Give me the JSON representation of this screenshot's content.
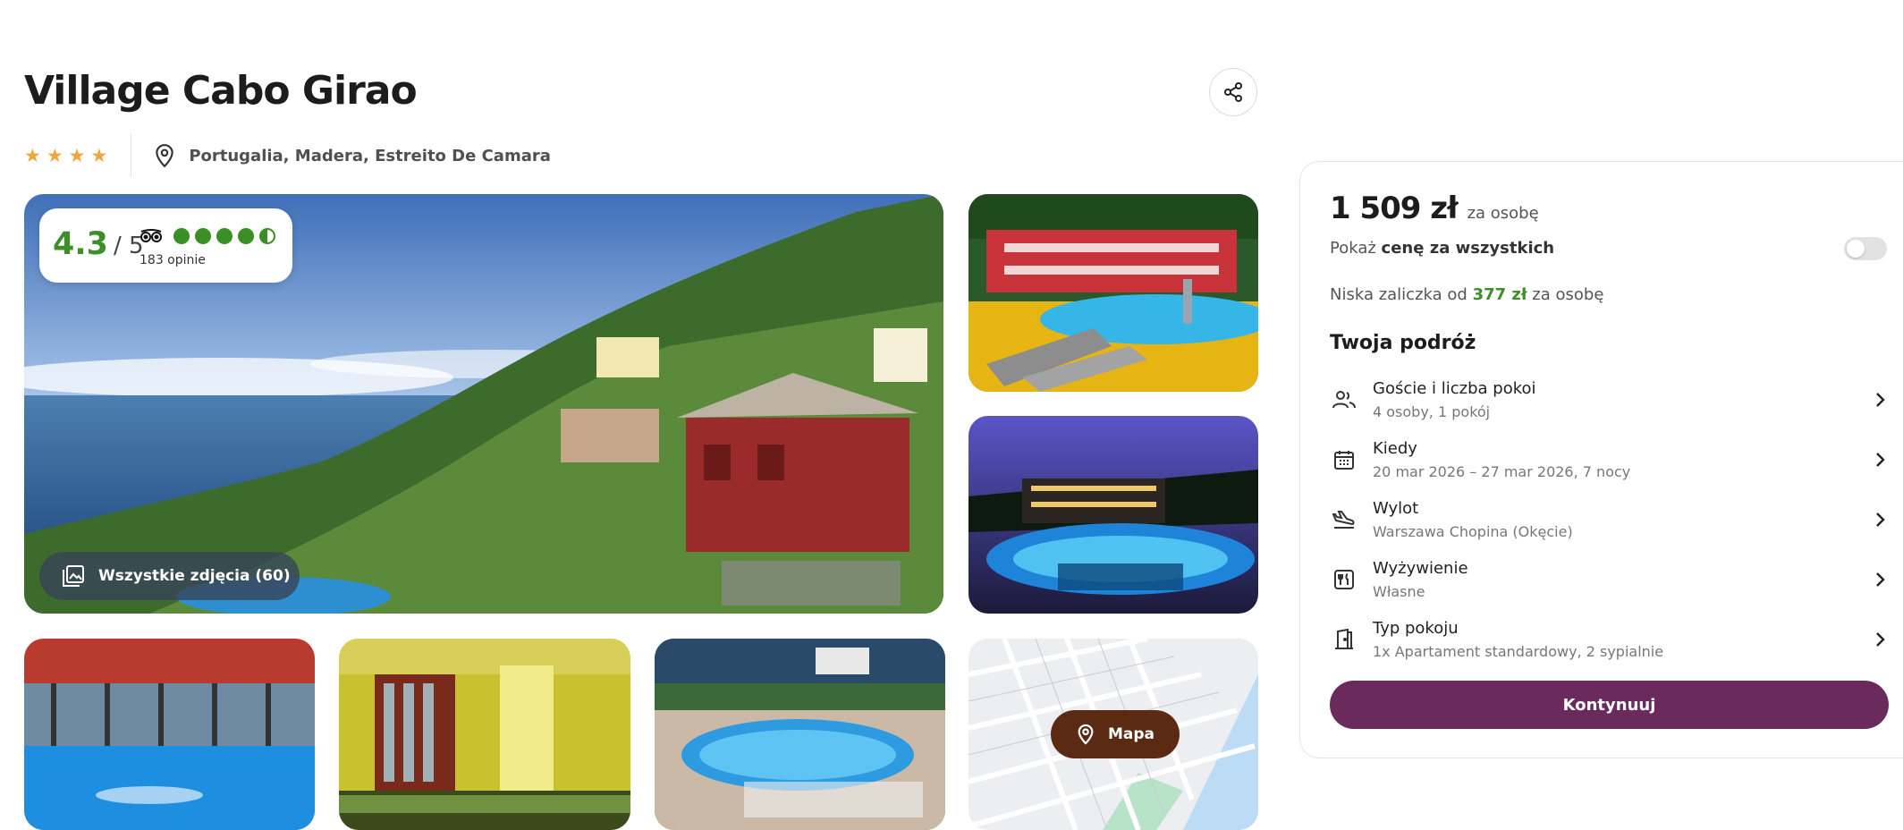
{
  "hotel": {
    "name": "Village Cabo Girao",
    "stars": 4,
    "location": "Portugalia, Madera, Estreito De Camara"
  },
  "rating": {
    "score": "4.3",
    "max": "/ 5",
    "bubbles": 4.5,
    "count_label": "183 opinie"
  },
  "gallery": {
    "all_photos_label": "Wszystkie zdjęcia (60)",
    "map_label": "Mapa"
  },
  "booking": {
    "price": "1 509 zł",
    "price_unit": "za osobę",
    "show_total_prefix": "Pokaż",
    "show_total_bold": "cenę za wszystkich",
    "toggle_on": false,
    "deposit_prefix": "Niska zaliczka od",
    "deposit_amount": "377 zł",
    "deposit_suffix": "za osobę",
    "trip_title": "Twoja podróż",
    "rows": [
      {
        "label": "Goście i liczba pokoi",
        "value": "4 osoby, 1 pokój",
        "icon": "guests-icon"
      },
      {
        "label": "Kiedy",
        "value": "20 mar 2026 – 27 mar 2026, 7 nocy",
        "icon": "calendar-icon"
      },
      {
        "label": "Wylot",
        "value": "Warszawa Chopina (Okęcie)",
        "icon": "plane-icon"
      },
      {
        "label": "Wyżywienie",
        "value": "Własne",
        "icon": "meal-icon"
      },
      {
        "label": "Typ pokoju",
        "value": "1x Apartament standardowy, 2 sypialnie",
        "icon": "door-icon"
      }
    ],
    "cta_label": "Kontynuuj"
  },
  "colors": {
    "star": "#f0a63a",
    "rating_green": "#3e8e2a",
    "cta": "#6a2b5c",
    "map_button": "#5a2a13"
  }
}
